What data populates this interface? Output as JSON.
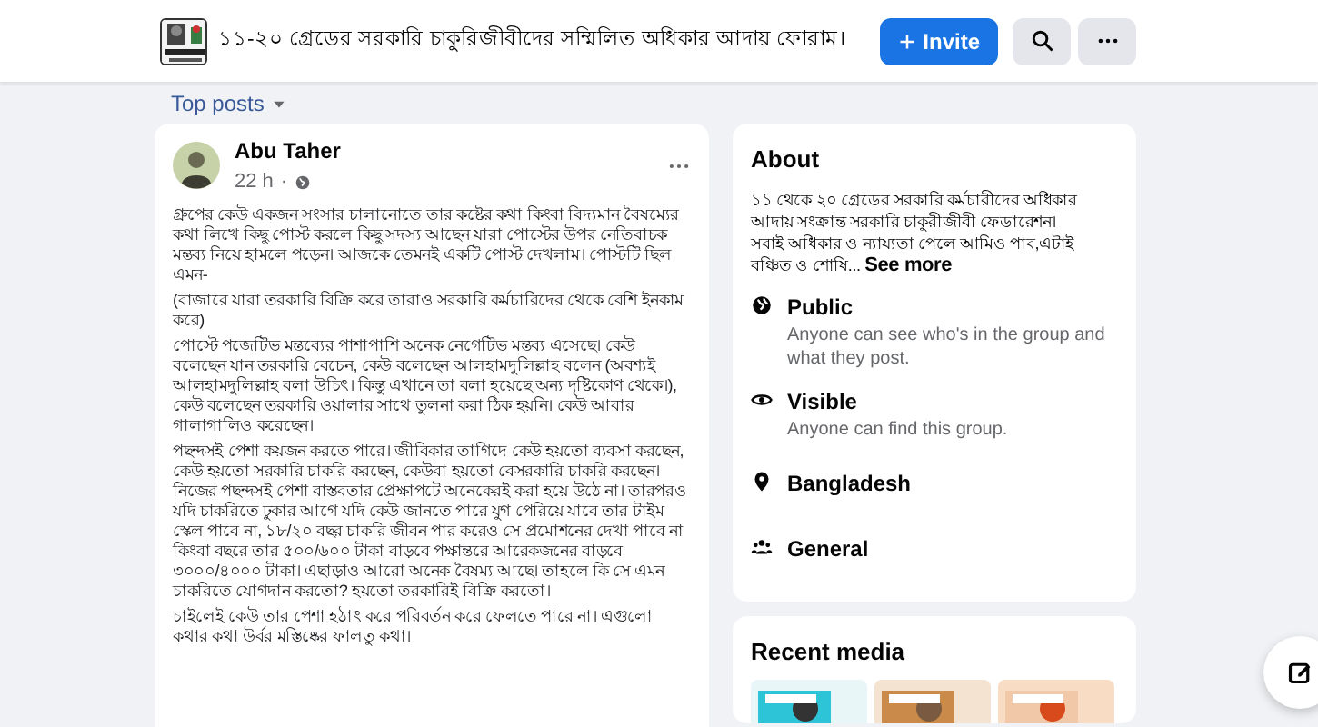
{
  "header": {
    "title": "১১-২০ গ্রেডের সরকারি চাকুরিজীবীদের সম্মিলিত অধিকার আদায় ফোরাম।",
    "invite": "Invite"
  },
  "sort": {
    "label": "Top posts"
  },
  "post": {
    "author": "Abu Taher",
    "time": "22 h",
    "separator": "·",
    "paragraphs": [
      "গ্রুপের কেউ একজন সংসার চালানোতে তার কষ্টের কথা কিংবা বিদ্যমান বৈষম্যের কথা লিখে কিছু পোস্ট করলে কিছু সদস্য আছেন যারা পোস্টের উপর নেতিবাচক মন্তব্য নিয়ে হামলে পড়েন। আজকে তেমনই একটি পোস্ট দেখলাম। পোস্টটি ছিল এমন-",
      "(বাজারে যারা তরকারি বিক্রি করে তারাও সরকারি কর্মচারিদের থেকে বেশি ইনকাম করে)",
      "পোস্টে পজেটিভ মন্তব্যের পাশাপাশি অনেক নেগেটিভ মন্তব্য এসেছে। কেউ বলেছেন যান তরকারি বেচেন, কেউ বলেছেন আলহামদুলিল্লাহ বলেন (অবশ্যই আলহামদুলিল্লাহ বলা উচিৎ। কিন্তু এখানে তা বলা হয়েছে অন্য দৃষ্টিকোণ থেকে।), কেউ বলেছেন তরকারি ওয়ালার সাথে তুলনা করা ঠিক হয়নি। কেউ আবার গালাগালিও করেছেন।",
      "পছন্দসই পেশা কয়জন করতে পারে। জীবিকার তাগিদে কেউ হয়তো ব্যবসা করছেন, কেউ হয়তো সরকারি চাকরি করছেন, কেউবা হয়তো বেসরকারি চাকরি করছেন। নিজের পছন্দসই পেশা বাস্তবতার প্রেক্ষাপটে অনেকেরই করা হয়ে উঠে না। তারপরও যদি চাকরিতে ঢুকার আগে যদি কেউ জানতে পারে যুগ পেরিয়ে যাবে তার টাইম স্কেল পাবে না, ১৮/২০ বছর চাকরি জীবন পার করেও সে প্রমোশনের দেখা পাবে না কিংবা বছরে তার ৫০০/৬০০ টাকা বাড়বে পক্ষান্তরে আরেকজনের বাড়বে ৩০০০/৪০০০ টাকা। এছাড়াও আরো অনেক বৈষম্য আছে। তাহলে কি সে এমন চাকরিতে যোগদান করতো? হয়তো তরকারিই বিক্রি করতো।",
      "চাইলেই কেউ তার পেশা হঠাৎ করে পরিবর্তন করে ফেলতে পারে না। এগুলো কথার কথা উর্বর মস্তিষ্কের ফালতু কথা।"
    ]
  },
  "about": {
    "title": "About",
    "description": [
      "১১ থেকে ২০ গ্রেডের সরকারি কর্মচারীদের অধিকার আদায় সংক্রান্ত সরকারি চাকুরীজীবী ফেডারেশন।",
      "সবাই অধিকার ও ন্যায্যতা পেলে আমিও পাব,এটাই বঞ্চিত ও শোষি..."
    ],
    "see_more": "See more",
    "items": [
      {
        "kind": "public",
        "title": "Public",
        "detail": "Anyone can see who's in the group and what they post."
      },
      {
        "kind": "visible",
        "title": "Visible",
        "detail": "Anyone can find this group."
      },
      {
        "kind": "location",
        "title": "Bangladesh"
      },
      {
        "kind": "category",
        "title": "General"
      }
    ]
  },
  "recent_media": {
    "title": "Recent media"
  }
}
